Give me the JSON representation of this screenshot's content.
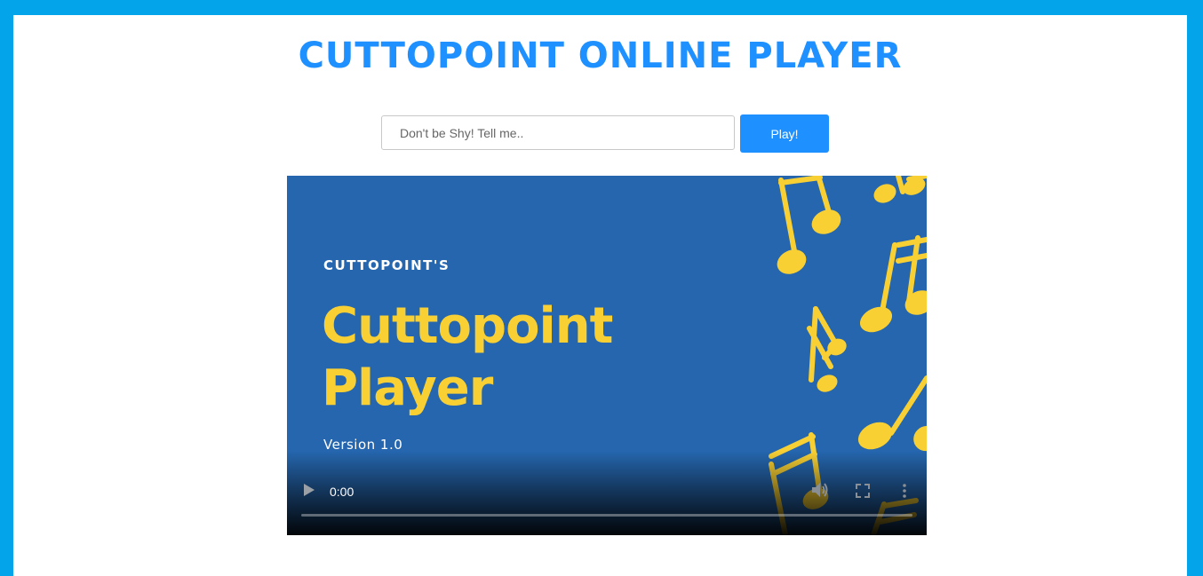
{
  "header": {
    "title": "CUTTOPOINT ONLINE PLAYER"
  },
  "search": {
    "placeholder": "Don't be Shy! Tell me..",
    "value": ""
  },
  "play_button": {
    "label": "Play!"
  },
  "video": {
    "poster": {
      "kicker": "CUTTOPOINT'S",
      "title_line1": "Cuttopoint",
      "title_line2": "Player",
      "version": "Version 1.0"
    },
    "controls": {
      "current_time": "0:00",
      "progress": 0
    },
    "icons": {
      "play": "play-icon",
      "volume": "volume-icon",
      "fullscreen": "fullscreen-icon",
      "more": "more-options-icon"
    }
  },
  "colors": {
    "frame": "#03a4e9",
    "accent": "#1e90ff",
    "poster_background": "#2566ae",
    "poster_yellow": "#f8d034"
  }
}
